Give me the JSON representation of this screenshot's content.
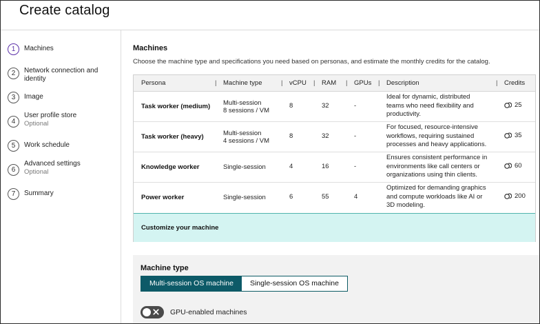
{
  "page": {
    "title": "Create catalog"
  },
  "steps": [
    {
      "num": "1",
      "label": "Machines",
      "sub": ""
    },
    {
      "num": "2",
      "label": "Network connection and identity",
      "sub": ""
    },
    {
      "num": "3",
      "label": "Image",
      "sub": ""
    },
    {
      "num": "4",
      "label": "User profile store",
      "sub": "Optional"
    },
    {
      "num": "5",
      "label": "Work schedule",
      "sub": ""
    },
    {
      "num": "6",
      "label": "Advanced settings",
      "sub": "Optional"
    },
    {
      "num": "7",
      "label": "Summary",
      "sub": ""
    }
  ],
  "machines": {
    "title": "Machines",
    "description": "Choose the machine type and specifications you need based on personas, and estimate the monthly credits for the catalog.",
    "columns": [
      "Persona",
      "Machine type",
      "vCPU",
      "RAM",
      "GPUs",
      "Description",
      "Credits"
    ],
    "separator": "|",
    "rows": [
      {
        "persona": "Task worker (medium)",
        "mt1": "Multi-session",
        "mt2": "8 sessions / VM",
        "vcpu": "8",
        "ram": "32",
        "gpus": "-",
        "desc": [
          "Ideal for dynamic, distributed",
          "teams who need flexibility and",
          "productivity."
        ],
        "credits": "25"
      },
      {
        "persona": "Task worker (heavy)",
        "mt1": "Multi-session",
        "mt2": "4 sessions / VM",
        "vcpu": "8",
        "ram": "32",
        "gpus": "-",
        "desc": [
          "For focused, resource-intensive",
          "workflows, requiring sustained",
          "processes and heavy applications."
        ],
        "credits": "35"
      },
      {
        "persona": "Knowledge worker",
        "mt1": "Single-session",
        "mt2": "",
        "vcpu": "4",
        "ram": "16",
        "gpus": "-",
        "desc": [
          "Ensures consistent performance in",
          "environments like call centers or",
          "organizations using thin clients."
        ],
        "credits": "60"
      },
      {
        "persona": "Power worker",
        "mt1": "Single-session",
        "mt2": "",
        "vcpu": "6",
        "ram": "55",
        "gpus": "4",
        "desc": [
          "Optimized for demanding graphics",
          "and compute workloads like AI or",
          "3D modeling."
        ],
        "credits": "200"
      }
    ],
    "custom_row": "Customize your machine"
  },
  "machine_type": {
    "title": "Machine type",
    "options": [
      "Multi-session OS machine",
      "Single-session OS machine"
    ],
    "selected": "Multi-session OS machine"
  },
  "gpu_toggle": {
    "label": "GPU-enabled machines",
    "on": false
  },
  "colors": {
    "accent": "#0d5a68",
    "highlight": "#d4f4f2",
    "step_active": "#5b2fa8"
  },
  "icons": {
    "credits": "credits-coin-icon",
    "toggle_off": "close-icon"
  }
}
